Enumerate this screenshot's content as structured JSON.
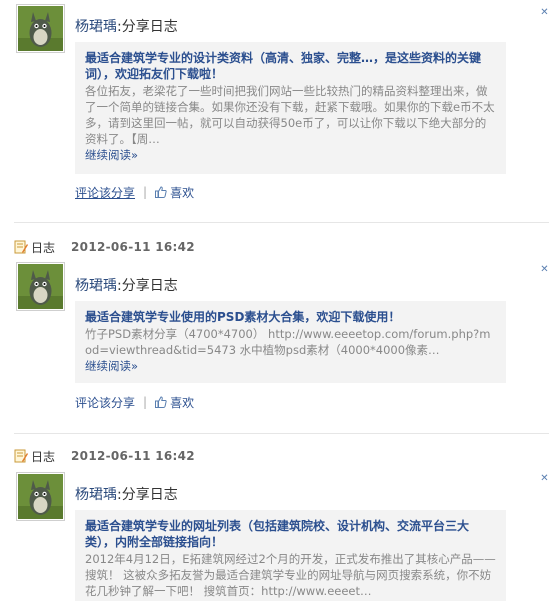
{
  "feed": [
    {
      "type_label": "",
      "timestamp": "",
      "author": "杨珺瑀",
      "action": ":分享日志",
      "share": {
        "title": "最适合建筑学专业的设计类资料（高清、独家、完整…，是这些资料的关键词），欢迎拓友们下载啦！",
        "body": "各位拓友，老梁花了一些时间把我们网站一些比较热门的精品资料整理出来，做了一个简单的链接合集。如果你还没有下载，赶紧下载哦。如果你的下载e币不太多，请到这里回一帖，就可以自动获得50e币了，可以让你下载以下绝大部分的资料了。【周…",
        "read_more": "继续阅读»"
      },
      "comment_label": "评论该分享",
      "like_label": "喜欢"
    },
    {
      "type_label": "日志",
      "timestamp": "2012-06-11 16:42",
      "author": "杨珺瑀",
      "action": ":分享日志",
      "share": {
        "title": "最适合建筑学专业使用的PSD素材大合集，欢迎下载使用！",
        "body": "竹子PSD素材分享（4700*4700） http://www.eeeetop.com/forum.php?mod=viewthread&tid=5473 水中植物psd素材（4000*4000像素…",
        "read_more": "继续阅读»"
      },
      "comment_label": "评论该分享",
      "like_label": "喜欢"
    },
    {
      "type_label": "日志",
      "timestamp": "2012-06-11 16:42",
      "author": "杨珺瑀",
      "action": ":分享日志",
      "share": {
        "title": "最适合建筑学专业的网址列表（包括建筑院校、设计机构、交流平台三大类），内附全部链接指向！",
        "body": "2012年4月12日，E拓建筑网经过2个月的开发，正式发布推出了其核心产品——搜筑！ 这被众多拓友誉为最适合建筑学专业的网址导航与网页搜索系统，你不妨花几秒钟了解一下吧！ 搜筑首页：http://www.eeeet…",
        "read_more": ""
      },
      "comment_label": "",
      "like_label": ""
    }
  ],
  "icons": {
    "close": "close-x-icon",
    "note": "note-icon",
    "thumb": "thumbs-up-icon",
    "avatar": "totoro-avatar"
  },
  "colors": {
    "link": "#2b4f8f",
    "share_bg": "#f3f3f3",
    "timestamp": "#666666"
  }
}
